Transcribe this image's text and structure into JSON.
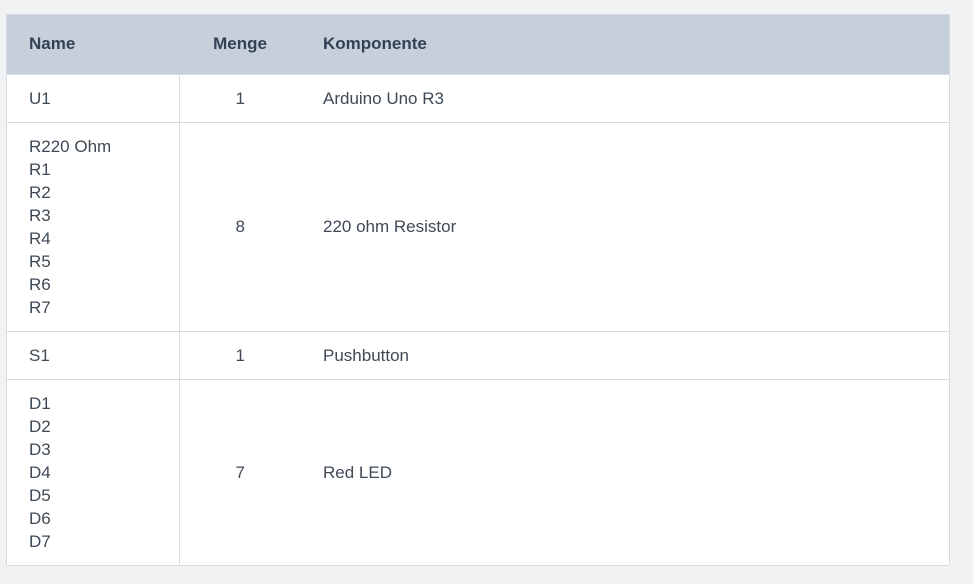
{
  "table": {
    "headers": {
      "name": "Name",
      "quantity": "Menge",
      "component": "Komponente"
    },
    "rows": [
      {
        "names": [
          "U1"
        ],
        "quantity": "1",
        "component": "Arduino Uno R3"
      },
      {
        "names": [
          "R220 Ohm",
          "R1",
          "R2",
          "R3",
          "R4",
          "R5",
          "R6",
          "R7"
        ],
        "quantity": "8",
        "component": "220 ohm Resistor"
      },
      {
        "names": [
          "S1"
        ],
        "quantity": "1",
        "component": "Pushbutton"
      },
      {
        "names": [
          "D1",
          "D2",
          "D3",
          "D4",
          "D5",
          "D6",
          "D7"
        ],
        "quantity": "7",
        "component": "Red LED"
      }
    ]
  }
}
